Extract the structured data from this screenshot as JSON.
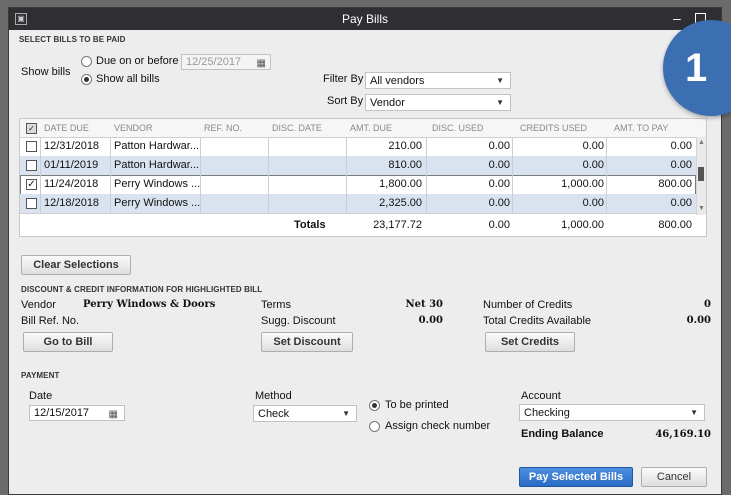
{
  "window": {
    "title": "Pay Bills",
    "badge": "1"
  },
  "select": {
    "section_title": "SELECT BILLS TO BE PAID",
    "show_bills_label": "Show bills",
    "due_on_label": "Due on or before",
    "due_date": "12/25/2017",
    "show_all_label": "Show all bills",
    "filter_by_label": "Filter By",
    "filter_value": "All vendors",
    "sort_by_label": "Sort By",
    "sort_value": "Vendor"
  },
  "grid": {
    "headers": [
      "DATE DUE",
      "VENDOR",
      "REF. NO.",
      "DISC. DATE",
      "AMT. DUE",
      "DISC. USED",
      "CREDITS USED",
      "AMT. TO PAY"
    ],
    "rows": [
      {
        "checked": false,
        "date_due": "12/31/2018",
        "vendor": "Patton Hardwar...",
        "ref": "",
        "disc_date": "",
        "amt_due": "210.00",
        "disc_used": "0.00",
        "credits_used": "0.00",
        "amt_to_pay": "0.00"
      },
      {
        "checked": false,
        "date_due": "01/11/2019",
        "vendor": "Patton Hardwar...",
        "ref": "",
        "disc_date": "",
        "amt_due": "810.00",
        "disc_used": "0.00",
        "credits_used": "0.00",
        "amt_to_pay": "0.00"
      },
      {
        "checked": true,
        "date_due": "11/24/2018",
        "vendor": "Perry Windows ...",
        "ref": "",
        "disc_date": "",
        "amt_due": "1,800.00",
        "disc_used": "0.00",
        "credits_used": "1,000.00",
        "amt_to_pay": "800.00"
      },
      {
        "checked": false,
        "date_due": "12/18/2018",
        "vendor": "Perry Windows ...",
        "ref": "",
        "disc_date": "",
        "amt_due": "2,325.00",
        "disc_used": "0.00",
        "credits_used": "0.00",
        "amt_to_pay": "0.00"
      }
    ],
    "totals_label": "Totals",
    "totals": {
      "amt_due": "23,177.72",
      "disc_used": "0.00",
      "credits_used": "1,000.00",
      "amt_to_pay": "800.00"
    },
    "check_glyph": "✓"
  },
  "clear_selections": "Clear Selections",
  "discount": {
    "section_title": "DISCOUNT & CREDIT INFORMATION FOR HIGHLIGHTED BILL",
    "vendor_label": "Vendor",
    "vendor_value": "Perry Windows & Doors",
    "bill_ref_label": "Bill Ref. No.",
    "terms_label": "Terms",
    "terms_value": "Net 30",
    "sugg_discount_label": "Sugg. Discount",
    "sugg_discount_value": "0.00",
    "num_credits_label": "Number of Credits",
    "num_credits_value": "0",
    "total_credits_label": "Total Credits Available",
    "total_credits_value": "0.00",
    "go_to_bill": "Go to Bill",
    "set_discount": "Set Discount",
    "set_credits": "Set Credits"
  },
  "payment": {
    "section_title": "PAYMENT",
    "date_label": "Date",
    "date_value": "12/15/2017",
    "method_label": "Method",
    "method_value": "Check",
    "to_be_printed": "To be printed",
    "assign_check": "Assign check number",
    "account_label": "Account",
    "account_value": "Checking",
    "ending_balance_label": "Ending Balance",
    "ending_balance_value": "46,169.10"
  },
  "buttons": {
    "pay_selected": "Pay Selected Bills",
    "cancel": "Cancel"
  },
  "colors": {
    "title_bar": "#2f2f33",
    "row_alt": "#d9e3ef",
    "primary_button": "#2a6bc4",
    "badge": "#3b6fb2"
  }
}
